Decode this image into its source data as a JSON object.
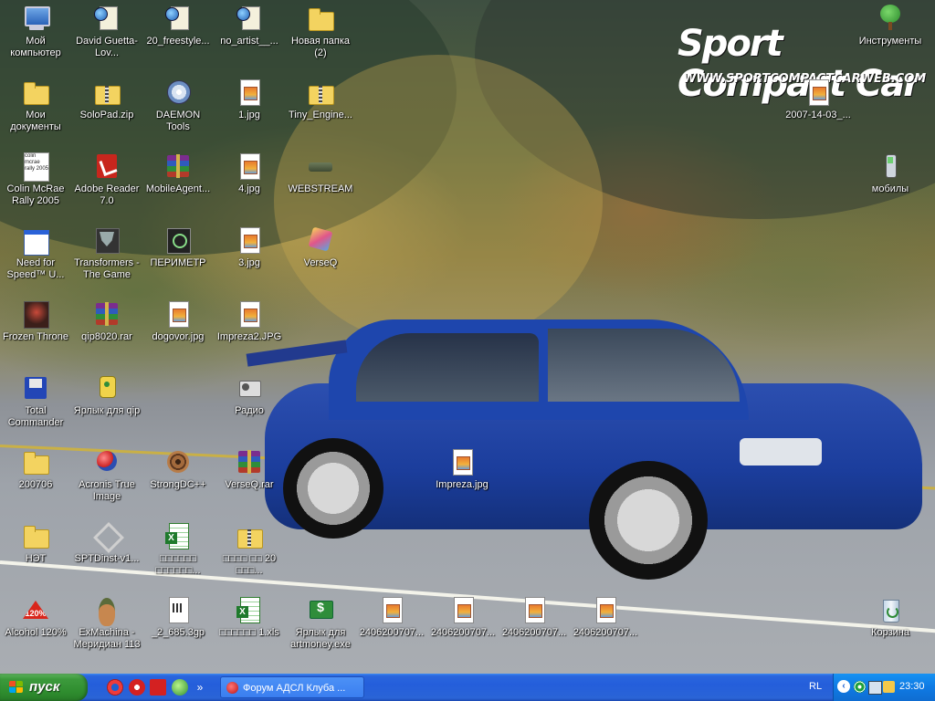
{
  "wallpaper": {
    "brand": "SPORT COMPACT CAR",
    "brand_display": "Sport Compact Car",
    "url": "WWW.SPORTCOMPACTCARWEB.COM"
  },
  "desktop_icons": [
    {
      "label": "Мой компьютер",
      "icon": "computer-icon"
    },
    {
      "label": "David Guetta-Lov...",
      "icon": "media-shortcut-icon"
    },
    {
      "label": "20_freestyle...",
      "icon": "media-shortcut-icon"
    },
    {
      "label": "no_artist__...",
      "icon": "media-shortcut-icon"
    },
    {
      "label": "Новая папка (2)",
      "icon": "folder-icon"
    },
    {
      "label": "Мои документы",
      "icon": "documents-folder-icon"
    },
    {
      "label": "SoloPad.zip",
      "icon": "zip-folder-icon"
    },
    {
      "label": "DAEMON Tools",
      "icon": "daemon-tools-icon"
    },
    {
      "label": "1.jpg",
      "icon": "jpg-file-icon"
    },
    {
      "label": "Tiny_Engine...",
      "icon": "zip-folder-icon"
    },
    {
      "label": "Colin McRae Rally 2005",
      "icon": "colin-mcrae-icon"
    },
    {
      "label": "Adobe Reader 7.0",
      "icon": "adobe-reader-icon"
    },
    {
      "label": "MobileAgent...",
      "icon": "rar-archive-icon"
    },
    {
      "label": "4.jpg",
      "icon": "jpg-file-icon"
    },
    {
      "label": "WEBSTREAM",
      "icon": "drive-icon"
    },
    {
      "label": "Need for Speed™ U...",
      "icon": "window-shortcut-icon"
    },
    {
      "label": "Transformers - The Game",
      "icon": "transformers-icon"
    },
    {
      "label": "ПЕРИМЕТР",
      "icon": "perimeter-icon"
    },
    {
      "label": "3.jpg",
      "icon": "jpg-file-icon"
    },
    {
      "label": "VerseQ",
      "icon": "verseq-icon"
    },
    {
      "label": "Frozen Throne",
      "icon": "frozen-throne-icon"
    },
    {
      "label": "qip8020.rar",
      "icon": "rar-archive-icon"
    },
    {
      "label": "dogovor.jpg",
      "icon": "jpg-file-icon"
    },
    {
      "label": "Impreza2.JPG",
      "icon": "jpg-file-icon"
    },
    {
      "label": "Total Commander",
      "icon": "floppy-disk-icon"
    },
    {
      "label": "Ярлык для qip",
      "icon": "qip-icon"
    },
    {
      "label": "Радио",
      "icon": "radio-icon"
    },
    {
      "label": "200706",
      "icon": "folder-icon"
    },
    {
      "label": "Acronis True Image",
      "icon": "acronis-icon"
    },
    {
      "label": "StrongDC++",
      "icon": "strongdc-icon"
    },
    {
      "label": "VerseQ.rar",
      "icon": "rar-archive-icon"
    },
    {
      "label": "Impreza.jpg",
      "icon": "jpg-file-icon"
    },
    {
      "label": "НЭТ",
      "icon": "folder-icon"
    },
    {
      "label": "SPTDinst-v1...",
      "icon": "sptd-installer-icon"
    },
    {
      "label": "□□□□□□ □□□□□□...",
      "icon": "excel-file-icon"
    },
    {
      "label": "□□□□ □□ 20 □□□...",
      "icon": "zip-folder-icon"
    },
    {
      "label": "Alcohol 120%",
      "icon": "alcohol-120-icon"
    },
    {
      "label": "ExMachina - Меридиан 113",
      "icon": "exmachina-icon"
    },
    {
      "label": "_2_685.3gp",
      "icon": "video-file-icon"
    },
    {
      "label": "□□□□□□ 1.xls",
      "icon": "excel-file-icon"
    },
    {
      "label": "Ярлык для artmoney.exe",
      "icon": "artmoney-icon"
    },
    {
      "label": "2406200707...",
      "icon": "jpg-file-icon"
    },
    {
      "label": "2406200707...",
      "icon": "jpg-file-icon"
    },
    {
      "label": "2406200707...",
      "icon": "jpg-file-icon"
    },
    {
      "label": "2406200707...",
      "icon": "jpg-file-icon"
    },
    {
      "label": "Инструменты",
      "icon": "tree-icon"
    },
    {
      "label": "2007-14-03_...",
      "icon": "jpg-file-icon"
    },
    {
      "label": "мобилы",
      "icon": "mobile-phone-icon"
    },
    {
      "label": "Корзина",
      "icon": "recycle-bin-icon"
    }
  ],
  "taskbar": {
    "start_label": "пуск",
    "quick_launch": [
      {
        "icon": "opera-icon"
      },
      {
        "icon": "quick-launch-red-icon"
      },
      {
        "icon": "acrobat-quick-icon"
      },
      {
        "icon": "green-quick-icon"
      },
      {
        "icon": "expand-quick-launch-icon"
      }
    ],
    "tasks": [
      {
        "label": "Форум АДСЛ Клуба ...",
        "icon": "opera-icon"
      }
    ],
    "language": "RL",
    "clock": "23:30"
  }
}
